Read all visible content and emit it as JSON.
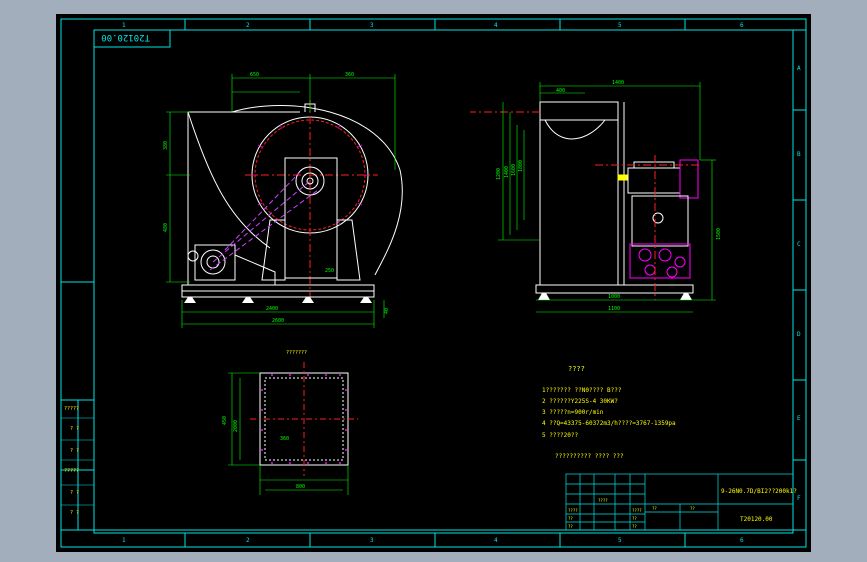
{
  "colors": {
    "background": "#a3aebd",
    "canvas": "#000000",
    "frame": "#00e5e5",
    "geometry": "#ffffff",
    "text": "#ffff00",
    "dimension": "#00ff00",
    "centerline": "#ff2020",
    "motor": "#ff00ff",
    "construction": "#cc44ff"
  },
  "drawing": {
    "code_box": "T20120.00",
    "code_small": "T20120.00",
    "title_cn": "9-26N0.7D/BI2??200k1?",
    "grid_top": [
      "1",
      "2",
      "3",
      "4",
      "5",
      "6"
    ],
    "grid_bottom": [
      "1",
      "2",
      "3",
      "4",
      "5",
      "6"
    ],
    "grid_right": [
      "A",
      "B",
      "C",
      "D",
      "E",
      "F"
    ]
  },
  "front_view": {
    "dims_top": [
      "650",
      "360"
    ],
    "dims_left": [
      "380",
      "480"
    ],
    "dims_bottom": [
      "2400",
      "2600"
    ],
    "dim_inner": "250",
    "dim_side": "40"
  },
  "side_view": {
    "dims_top": [
      "1400",
      "400"
    ],
    "dims_left": [
      "1200",
      "1400",
      "1600",
      "1800"
    ],
    "dims_bottom": [
      "1000",
      "1100"
    ],
    "dim_right": "1500"
  },
  "bottom_view": {
    "title": "???????",
    "dim_left": "450",
    "dim_left_inner": "2000",
    "dim_bottom": "800",
    "dim_inner": "360"
  },
  "tech_notes": {
    "heading": "????",
    "lines": [
      "1??????? ??N0???? B???",
      "2 ??????Y225S-4 30KW?",
      "3 ?????n=900r/min",
      "4 ??Q=43375-60372m3/h????=3767-1359pa",
      "5 ????20??"
    ],
    "footer": "?????????? ???? ???"
  },
  "title_block": {
    "name": "9-26N0.7D/BI2??200k1?",
    "number": "T20120.00",
    "cells": [
      "????",
      "??",
      "??"
    ],
    "row_labels": [
      "????",
      "??",
      "??",
      "????",
      "??",
      "??"
    ]
  },
  "left_strip": {
    "labels": [
      "?????",
      "? ?",
      "? ?",
      "?????",
      "? ?",
      "? ?"
    ]
  }
}
